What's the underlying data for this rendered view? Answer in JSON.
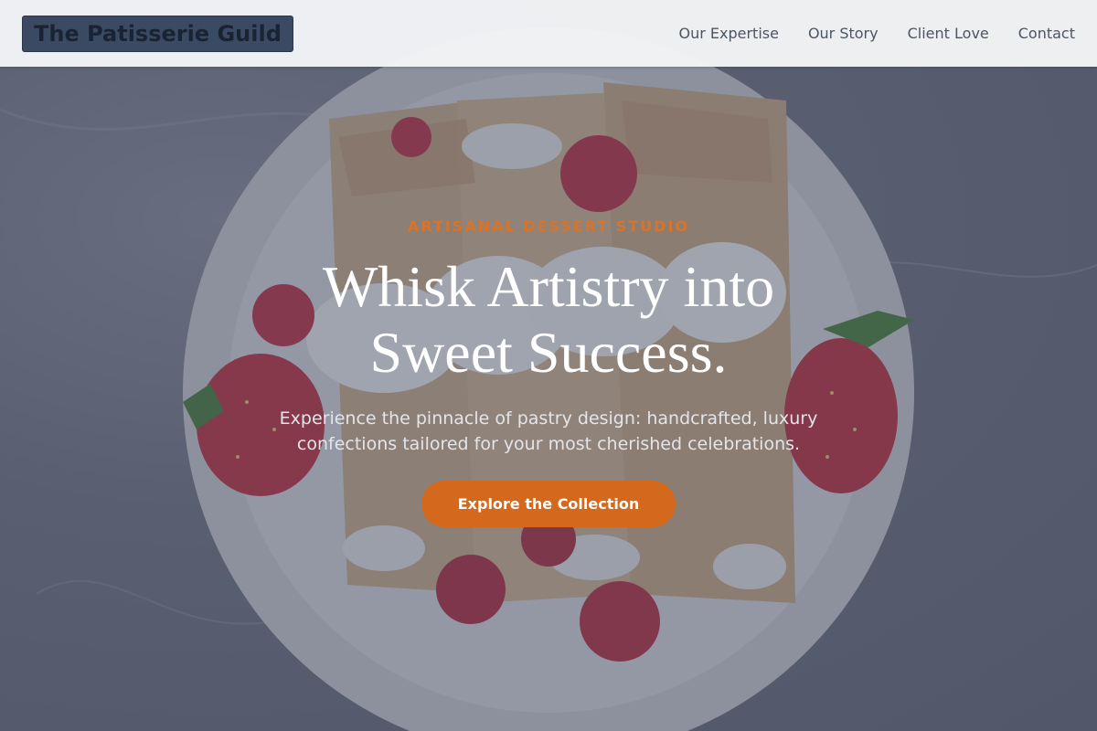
{
  "header": {
    "brand": "The Patisserie Guild",
    "nav": [
      {
        "label": "Our Expertise"
      },
      {
        "label": "Our Story"
      },
      {
        "label": "Client Love"
      },
      {
        "label": "Contact"
      }
    ]
  },
  "hero": {
    "eyebrow": "ARTISANAL DESSERT STUDIO",
    "headline_line1": "Whisk Artistry into",
    "headline_line2": "Sweet Success.",
    "subtext_line1": "Experience the pinnacle of pastry design: handcrafted, luxury",
    "subtext_line2": "confections tailored for your most cherished celebrations.",
    "cta_label": "Explore the Collection"
  },
  "colors": {
    "accent": "#d4681c",
    "eyebrow": "#d8742a",
    "header_bg": "#f3f4f6",
    "logo_bg": "#3b4a63"
  }
}
